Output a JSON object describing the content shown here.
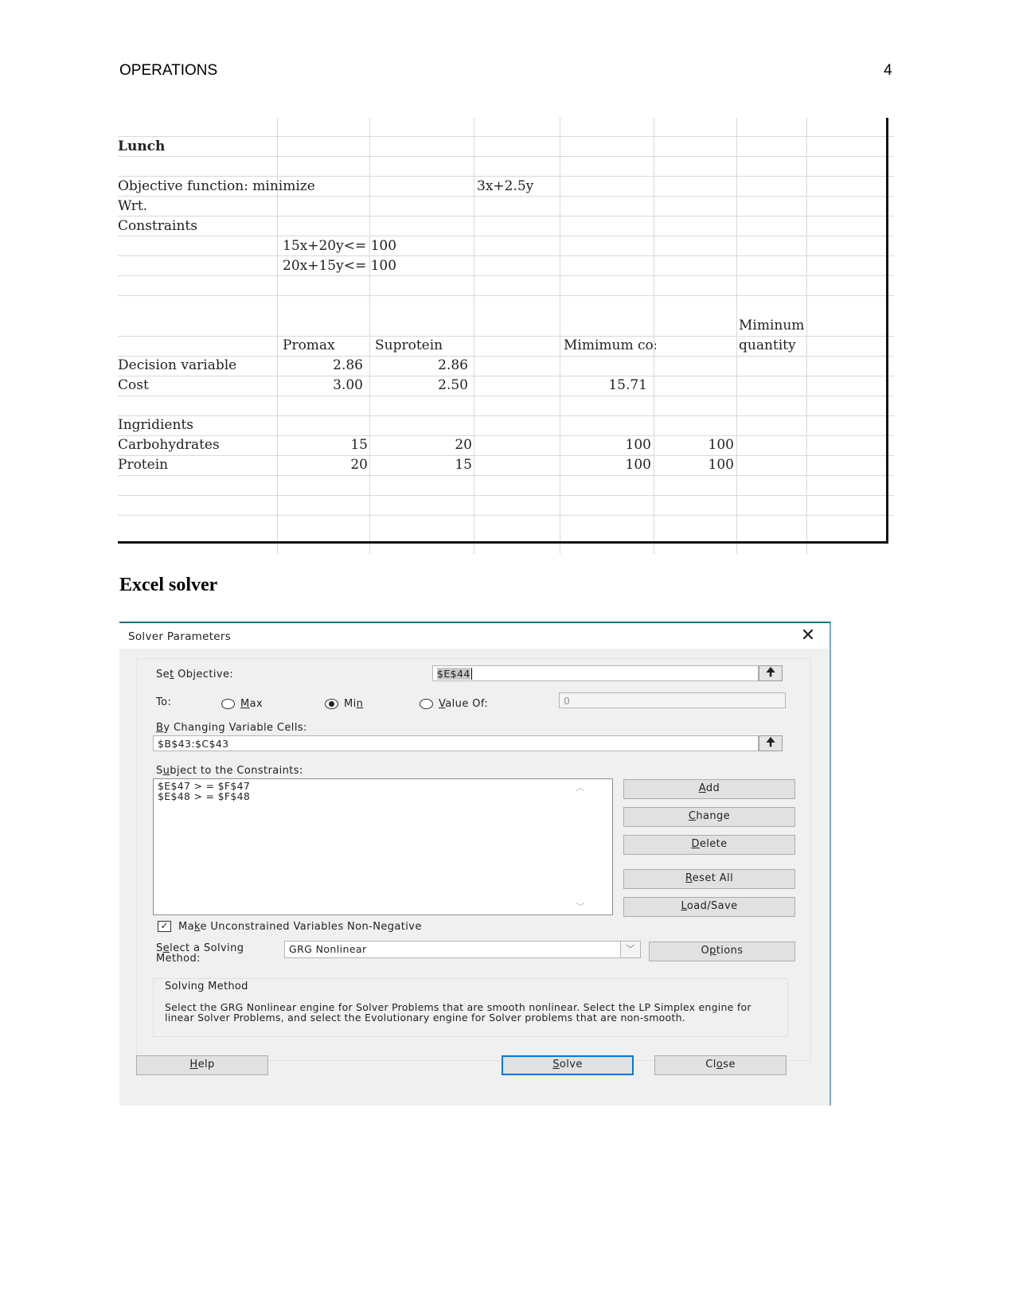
{
  "header": {
    "running_head": "OPERATIONS",
    "page_number": "4"
  },
  "spreadsheet": {
    "title": "Lunch",
    "objective_label": "Objective function: minimize",
    "objective_expr": "3x+2.5y",
    "wrt_label": "Wrt.",
    "constraints_label": "Constraints",
    "constraint_1": "15x+20y<= 100",
    "constraint_2": "20x+15y<= 100",
    "columns": {
      "promax": "Promax",
      "suprotein": "Suprotein",
      "minimum_cost": "Mimimum co:",
      "minimum_quantity_line1": "Miminum",
      "minimum_quantity_line2": "quantity"
    },
    "rows": {
      "decision_variable": {
        "label": "Decision variable",
        "promax": "2.86",
        "suprotein": "2.86"
      },
      "cost": {
        "label": "Cost",
        "promax": "3.00",
        "suprotein": "2.50",
        "minimum_cost": "15.71"
      },
      "ingredients": {
        "label": "Ingridients"
      },
      "carbohydrates": {
        "label": "Carbohydrates",
        "promax": "15",
        "suprotein": "20",
        "minimum_cost": "100",
        "minimum_quantity": "100"
      },
      "protein": {
        "label": "Protein",
        "promax": "20",
        "suprotein": "15",
        "minimum_cost": "100",
        "minimum_quantity": "100"
      }
    }
  },
  "section_title": "Excel solver",
  "dialog": {
    "title": "Solver Parameters",
    "close_glyph": "✕",
    "set_objective": {
      "label_pre": "Se",
      "label_u": "t",
      "label_post": " Objective:",
      "value": "$E$44"
    },
    "to_label": "To:",
    "options": {
      "max": {
        "u": "M",
        "rest": "ax",
        "selected": false
      },
      "min": {
        "pre": "Mi",
        "u": "n",
        "selected": true
      },
      "value_of": {
        "u": "V",
        "rest": "alue Of:",
        "selected": false,
        "value": "0"
      }
    },
    "changing_cells": {
      "label_u": "B",
      "label_rest": "y Changing Variable Cells:",
      "value": "$B$43:$C$43"
    },
    "constraints": {
      "label_pre": "S",
      "label_u": "u",
      "label_rest": "bject to the Constraints:",
      "items": [
        "$E$47 > = $F$47",
        "$E$48 > = $F$48"
      ]
    },
    "buttons": {
      "add": {
        "u": "A",
        "rest": "dd"
      },
      "change": {
        "u": "C",
        "rest": "hange"
      },
      "delete": {
        "u": "D",
        "rest": "elete"
      },
      "reset_all": {
        "u": "R",
        "rest": "eset All"
      },
      "load_save": {
        "u": "L",
        "rest": "oad/Save"
      },
      "options": {
        "pre": "O",
        "u": "p",
        "rest": "tions"
      },
      "help": {
        "u": "H",
        "rest": "elp"
      },
      "solve": {
        "u": "S",
        "rest": "olve"
      },
      "close": {
        "pre": "Cl",
        "u": "o",
        "rest": "se"
      }
    },
    "non_negative": {
      "checked": true,
      "check_glyph": "✓",
      "pre": "Ma",
      "u": "k",
      "rest": "e Unconstrained Variables Non-Negative"
    },
    "solving_method": {
      "label_pre": "S",
      "label_u": "e",
      "label_rest": "lect a Solving",
      "label_line2": "Method:",
      "value": "GRG Nonlinear",
      "arrow": "﹀"
    },
    "solving_method_group": {
      "title": "Solving Method",
      "description": "Select the GRG Nonlinear engine for Solver Problems that are smooth nonlinear. Select the LP Simplex engine for linear Solver Problems, and select the Evolutionary engine for Solver problems that are non-smooth."
    },
    "icons": {
      "collapse": "🠉",
      "scroll_up": "︿",
      "scroll_down": "﹀"
    }
  }
}
